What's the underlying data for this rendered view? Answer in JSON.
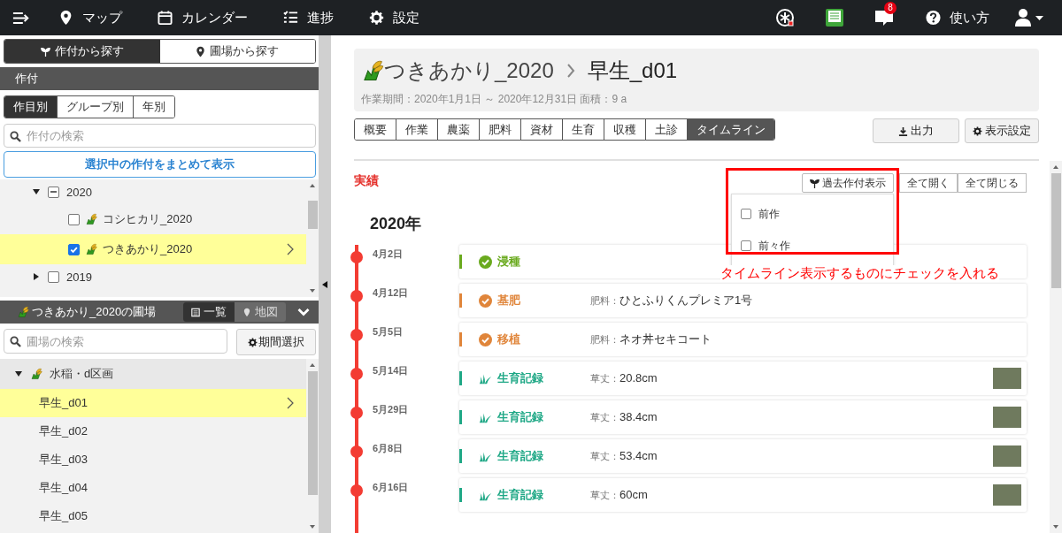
{
  "nav": {
    "items": [
      {
        "label": "マップ"
      },
      {
        "label": "カレンダー"
      },
      {
        "label": "進捗"
      },
      {
        "label": "設定"
      }
    ],
    "notification_count": "8",
    "help_label": "使い方"
  },
  "sidebar": {
    "search_tabs": [
      {
        "label": "作付から探す",
        "selected": true
      },
      {
        "label": "圃場から探す",
        "selected": false
      }
    ],
    "crop_section": {
      "title": "作付",
      "view_tabs": [
        {
          "label": "作目別",
          "selected": true
        },
        {
          "label": "グループ別",
          "selected": false
        },
        {
          "label": "年別",
          "selected": false
        }
      ],
      "search_placeholder": "作付の検索",
      "show_selected_button": "選択中の作付をまとめて表示",
      "tree": [
        {
          "label": "2020",
          "expanded": true,
          "indeterminate": true,
          "children": [
            {
              "label": "コシヒカリ_2020",
              "checked": false,
              "selected": false
            },
            {
              "label": "つきあかり_2020",
              "checked": true,
              "selected": true
            }
          ]
        },
        {
          "label": "2019",
          "expanded": false,
          "checked": false,
          "indeterminate": false
        }
      ]
    },
    "field_section": {
      "title": "つきあかり_2020の圃場",
      "view_tabs": [
        {
          "label": "一覧",
          "selected": true
        },
        {
          "label": "地図",
          "selected": false
        }
      ],
      "search_placeholder": "圃場の検索",
      "period_button": "期間選択",
      "tree": [
        {
          "label": "水稲・d区画",
          "expanded": true,
          "children": [
            {
              "label": "早生_d01",
              "selected": true
            },
            {
              "label": "早生_d02",
              "selected": false
            },
            {
              "label": "早生_d03",
              "selected": false
            },
            {
              "label": "早生_d04",
              "selected": false
            },
            {
              "label": "早生_d05",
              "selected": false
            }
          ]
        }
      ]
    }
  },
  "main": {
    "breadcrumb": [
      "つきあかり_2020",
      "早生_d01"
    ],
    "meta": "作業期間：2020年1月1日 ～ 2020年12月31日  面積：9 a",
    "tabs": [
      {
        "label": "概要",
        "selected": false
      },
      {
        "label": "作業",
        "selected": false
      },
      {
        "label": "農薬",
        "selected": false
      },
      {
        "label": "肥料",
        "selected": false
      },
      {
        "label": "資材",
        "selected": false
      },
      {
        "label": "生育",
        "selected": false
      },
      {
        "label": "収穫",
        "selected": false
      },
      {
        "label": "土診",
        "selected": false
      },
      {
        "label": "タイムライン",
        "selected": true
      }
    ],
    "export_button": "出力",
    "display_settings_button": "表示設定",
    "timeline": {
      "section_label": "実績",
      "past_crops_button": "過去作付表示",
      "past_crop_options": [
        {
          "label": "前作",
          "checked": false
        },
        {
          "label": "前々作",
          "checked": false
        }
      ],
      "expand_all": "全て開く",
      "collapse_all": "全て閉じる",
      "year": "2020年",
      "events": [
        {
          "date": "4月2日",
          "kind": "work",
          "label": "浸種",
          "color": "#6aaa1e",
          "photo": false
        },
        {
          "date": "4月12日",
          "kind": "work",
          "label": "基肥",
          "color": "#e0853a",
          "detail_label": "肥料：",
          "detail_value": "ひとふりくんプレミア1号",
          "photo": false
        },
        {
          "date": "5月5日",
          "kind": "work",
          "label": "移植",
          "color": "#e0853a",
          "detail_label": "肥料：",
          "detail_value": "ネオ丼セキコート",
          "photo": false
        },
        {
          "date": "5月14日",
          "kind": "growth",
          "label": "生育記録",
          "color": "#1fa886",
          "detail_label": "草丈：",
          "detail_value": "20.8cm",
          "photo": true
        },
        {
          "date": "5月29日",
          "kind": "growth",
          "label": "生育記録",
          "color": "#1fa886",
          "detail_label": "草丈：",
          "detail_value": "38.4cm",
          "photo": true
        },
        {
          "date": "6月8日",
          "kind": "growth",
          "label": "生育記録",
          "color": "#1fa886",
          "detail_label": "草丈：",
          "detail_value": "53.4cm",
          "photo": true
        },
        {
          "date": "6月16日",
          "kind": "growth",
          "label": "生育記録",
          "color": "#1fa886",
          "detail_label": "草丈：",
          "detail_value": "60cm",
          "photo": true
        }
      ]
    },
    "annotation": "タイムライン表示するものにチェックを入れる"
  }
}
